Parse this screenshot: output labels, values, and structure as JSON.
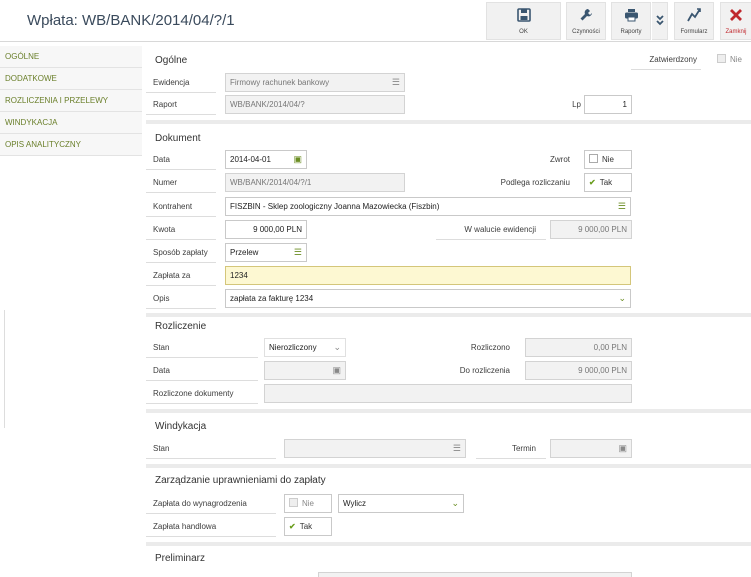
{
  "window": {
    "title": "Wpłata: WB/BANK/2014/04/?/1"
  },
  "toolbar": {
    "ok": "OK",
    "czynnosci": "Czynności",
    "raporty": "Raporty",
    "formularz": "Formularz",
    "zamknij": "Zamknij"
  },
  "sidebar": {
    "items": [
      {
        "label": "OGÓLNE"
      },
      {
        "label": "DODATKOWE"
      },
      {
        "label": "ROZLICZENIA I PRZELEWY"
      },
      {
        "label": "WINDYKACJA"
      },
      {
        "label": "OPIS ANALITYCZNY"
      }
    ]
  },
  "ogolne": {
    "title": "Ogólne",
    "zatwierdzony_label": "Zatwierdzony",
    "zatwierdzony_value": "Nie",
    "ewidencja_label": "Ewidencja",
    "ewidencja_value": "Firmowy rachunek bankowy",
    "raport_label": "Raport",
    "raport_value": "WB/BANK/2014/04/?",
    "lp_label": "Lp",
    "lp_value": "1"
  },
  "dokument": {
    "title": "Dokument",
    "data_label": "Data",
    "data_value": "2014-04-01",
    "zwrot_label": "Zwrot",
    "zwrot_value": "Nie",
    "numer_label": "Numer",
    "numer_value": "WB/BANK/2014/04/?/1",
    "podlega_label": "Podlega rozliczaniu",
    "podlega_value": "Tak",
    "kontrahent_label": "Kontrahent",
    "kontrahent_value": "FISZBIN - Sklep zoologiczny Joanna Mazowiecka  (Fiszbin)",
    "kwota_label": "Kwota",
    "kwota_value": "9 000,00 PLN",
    "waluta_label": "W walucie ewidencji",
    "waluta_value": "9 000,00 PLN",
    "sposob_label": "Sposób zapłaty",
    "sposob_value": "Przelew",
    "zaplata_label": "Zapłata za",
    "zaplata_value": "1234",
    "opis_label": "Opis",
    "opis_value": "zapłata za fakturę 1234"
  },
  "rozliczenie": {
    "title": "Rozliczenie",
    "stan_label": "Stan",
    "stan_value": "Nierozliczony",
    "rozliczono_label": "Rozliczono",
    "rozliczono_value": "0,00 PLN",
    "data_label": "Data",
    "do_rozliczenia_label": "Do rozliczenia",
    "do_rozliczenia_value": "9 000,00 PLN",
    "dokumenty_label": "Rozliczone dokumenty"
  },
  "windykacja": {
    "title": "Windykacja",
    "stan_label": "Stan",
    "termin_label": "Termin"
  },
  "uprawnienia": {
    "title": "Zarządzanie uprawnieniami do zapłaty",
    "wynagrodzenia_label": "Zapłata do wynagrodzenia",
    "wynagrodzenia_value": "Nie",
    "wylicz_value": "Wylicz",
    "handlowa_label": "Zapłata handlowa",
    "handlowa_value": "Tak"
  },
  "preliminarz": {
    "title": "Preliminarz"
  },
  "colors": {
    "accent": "#6b8e23",
    "highlight": "#fdf8d2",
    "close": "#c0282d"
  }
}
